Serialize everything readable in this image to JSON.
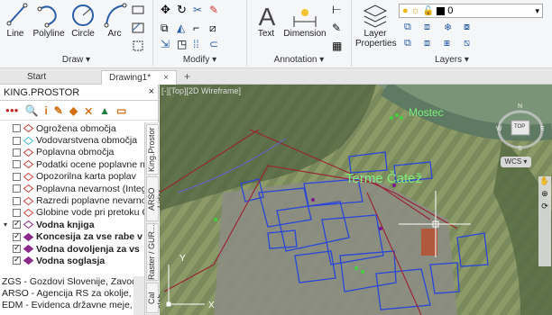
{
  "ribbon": {
    "draw": {
      "title": "Draw",
      "tools": [
        "Line",
        "Polyline",
        "Circle",
        "Arc"
      ]
    },
    "modify": {
      "title": "Modify"
    },
    "annotation": {
      "title": "Annotation",
      "tools": [
        "Text",
        "Dimension"
      ]
    },
    "layers": {
      "title": "Layers",
      "tool": "Layer\nProperties",
      "layer_value": "0"
    }
  },
  "tabs": {
    "start": "Start",
    "drawing": "Drawing1*",
    "close": "×",
    "add": "+"
  },
  "panel": {
    "title": "KING.PROSTOR",
    "close": "×",
    "toolbar": [
      "●●●",
      "🔍",
      "i",
      "✎",
      "◆",
      "⨯",
      "▲",
      "▭"
    ],
    "tree": [
      {
        "label": "Ogrožena območja",
        "checked": false,
        "color": "#d04040",
        "indent": 0
      },
      {
        "label": "Vodovarstvena območja",
        "checked": false,
        "color": "#40c0d0",
        "indent": 0
      },
      {
        "label": "Poplavna območja",
        "checked": false,
        "color": "#d04040",
        "indent": 0
      },
      {
        "label": "Podatki ocene poplavne n",
        "checked": false,
        "color": "#d04040",
        "indent": 0
      },
      {
        "label": "Opozorilna karta poplav",
        "checked": false,
        "color": "#d04040",
        "indent": 0
      },
      {
        "label": "Poplavna nevarnost (Integ",
        "checked": false,
        "color": "#d04040",
        "indent": 0
      },
      {
        "label": "Razredi poplavne nevarno",
        "checked": false,
        "color": "#d04040",
        "indent": 0
      },
      {
        "label": "Globine vode pri pretoku G",
        "checked": false,
        "color": "#d04040",
        "indent": 0
      },
      {
        "label": "Vodna knjiga",
        "checked": true,
        "color": "#8a2a8a",
        "indent": 0,
        "bold": true
      },
      {
        "label": "Koncesija za vse rabe v",
        "checked": true,
        "color": "#8a2a8a",
        "indent": 1,
        "bold": true
      },
      {
        "label": "Vodna dovoljenja za vs",
        "checked": true,
        "color": "#8a2a8a",
        "indent": 1,
        "bold": true
      },
      {
        "label": "Vodna soglasja",
        "checked": true,
        "color": "#8a2a8a",
        "indent": 1,
        "bold": true
      }
    ],
    "bottom": [
      "ZGS - Gozdovi Slovenije, Zavod z",
      "ARSO - Agencija RS za okolje, Mi",
      "EDM - Evidenca državne meje, G"
    ],
    "vtabs": [
      "King.Prostor",
      "ARSO Lidar",
      "Raster / GUR...",
      "Cal slab..."
    ]
  },
  "viewport": {
    "label": "[-][Top][2D Wireframe]",
    "labels": {
      "mostec": "Mostec",
      "terme": "Terme Čatež"
    },
    "viewcube": {
      "top": "TOP",
      "wcs": "WCS",
      "n": "N",
      "s": "S",
      "e": "E",
      "w": "W"
    },
    "ucs": {
      "y": "Y",
      "x": "X"
    }
  }
}
